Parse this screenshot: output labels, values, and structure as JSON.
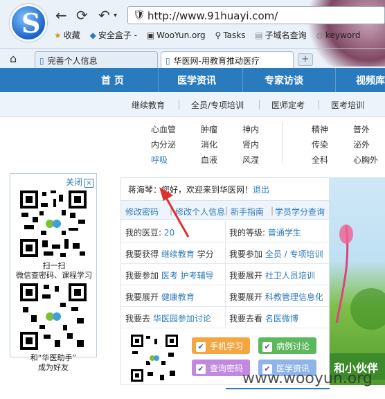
{
  "browser": {
    "url": "http://www.91huayi.com/",
    "bookmarks": [
      {
        "label": "收藏"
      },
      {
        "label": "安全盒子 -"
      },
      {
        "label": "WooYun.org"
      },
      {
        "label": "Tasks"
      },
      {
        "label": "子域名查询"
      },
      {
        "label": "keyword"
      }
    ],
    "tabs": [
      {
        "label": "完善个人信息"
      },
      {
        "label": "华医网-用教育推动医疗"
      }
    ],
    "newtab_label": "+"
  },
  "mainnav": {
    "items": [
      "首 页",
      "医学资讯",
      "专家访谈",
      "视频库"
    ]
  },
  "subnav": {
    "items": [
      "继续教育",
      "全员/专项培训",
      "医师定考",
      "医考培训"
    ]
  },
  "departments": {
    "col1": [
      "心血管",
      "内分泌",
      "呼吸"
    ],
    "col2": [
      "肿瘤",
      "消化",
      "血液"
    ],
    "col3": [
      "神内",
      "肾内",
      "风湿"
    ],
    "col4": [
      "精神",
      "传染",
      "全科"
    ],
    "col5": [
      "普外",
      "泌外",
      "心胸外"
    ]
  },
  "left_panel": {
    "close_label": "关闭",
    "close_x": "×",
    "qr1_caption_1": "扫一扫",
    "qr1_caption_2": "微信查密码、课程学习",
    "qr2_caption_1": "和“华医助手”",
    "qr2_caption_2": "成为好友"
  },
  "user_panel": {
    "username": "蒋海琴",
    "greeting": "：您好，欢迎来到华医网！",
    "logout": "退出",
    "quicklinks": [
      "修改密码",
      "修改个人信息",
      "新手指南",
      "学员学分查询"
    ],
    "rows": [
      {
        "left_prefix": "我的医豆:",
        "left_link": "20",
        "left_suffix": "",
        "right_prefix": "我的等级:",
        "right_link": "普通学生",
        "right_suffix": ""
      },
      {
        "left_prefix": "我要获得",
        "left_link": "继续教育",
        "left_suffix": "学分",
        "right_prefix": "我要参加",
        "right_link": "全员 / 专项培训",
        "right_suffix": ""
      },
      {
        "left_prefix": "我要参加",
        "left_link": "医考 护考辅导",
        "left_suffix": "",
        "right_prefix": "我要展开",
        "right_link": "社卫人员培训",
        "right_suffix": ""
      },
      {
        "left_prefix": "我要展开",
        "left_link": "健康教育",
        "left_suffix": "",
        "right_prefix": "我要展开",
        "right_link": "科教管理信息化",
        "right_suffix": ""
      },
      {
        "left_prefix": "我要去",
        "left_link": "华医园参加讨论",
        "left_suffix": "",
        "right_prefix": "我要去看",
        "right_link": "名医微博",
        "right_suffix": ""
      }
    ],
    "pills": [
      {
        "label": "手机学习",
        "color": "#f4a640"
      },
      {
        "label": "病例讨论",
        "color": "#5cb85c"
      },
      {
        "label": "查询密码",
        "color": "#c18ae0"
      },
      {
        "label": "医学资讯",
        "color": "#8fb4e8"
      }
    ]
  },
  "banner": {
    "text": "和小伙伴"
  },
  "watermark": "www.wooyun.org",
  "colors": {
    "nav_blue": "#2a7bbd",
    "link_blue": "#2a7bbd",
    "arrow_red": "#e0302c"
  }
}
